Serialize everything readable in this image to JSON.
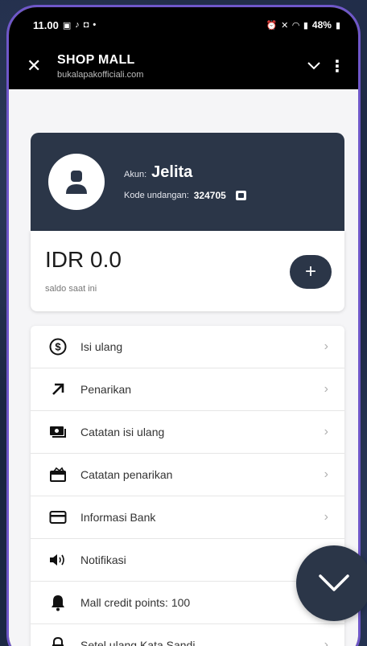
{
  "status_bar": {
    "time": "11.00",
    "battery": "48%"
  },
  "browser": {
    "close_icon": "close-icon",
    "title": "SHOP MALL",
    "url": "bukalapakofficiali.com"
  },
  "account": {
    "label": "Akun:",
    "name": "Jelita",
    "referral_label": "Kode undangan:",
    "referral_code": "324705"
  },
  "balance": {
    "amount": "IDR 0.0",
    "caption": "saldo saat ini",
    "add_label": "+"
  },
  "menu": {
    "items": [
      {
        "label": "Isi ulang",
        "icon": "dollar-circle-icon"
      },
      {
        "label": "Penarikan",
        "icon": "arrow-up-right-icon"
      },
      {
        "label": "Catatan isi ulang",
        "icon": "cash-icon"
      },
      {
        "label": "Catatan penarikan",
        "icon": "wallet-icon"
      },
      {
        "label": "Informasi Bank",
        "icon": "credit-card-icon"
      },
      {
        "label": "Notifikasi",
        "icon": "speaker-icon"
      },
      {
        "label": "Mall credit points:  100",
        "icon": "bell-icon"
      },
      {
        "label": "Setel ulang Kata Sandi",
        "icon": "lock-icon"
      }
    ]
  },
  "colors": {
    "primary": "#2b3648",
    "phone_frame": "#6f57c9",
    "background": "#f5f5f7"
  }
}
